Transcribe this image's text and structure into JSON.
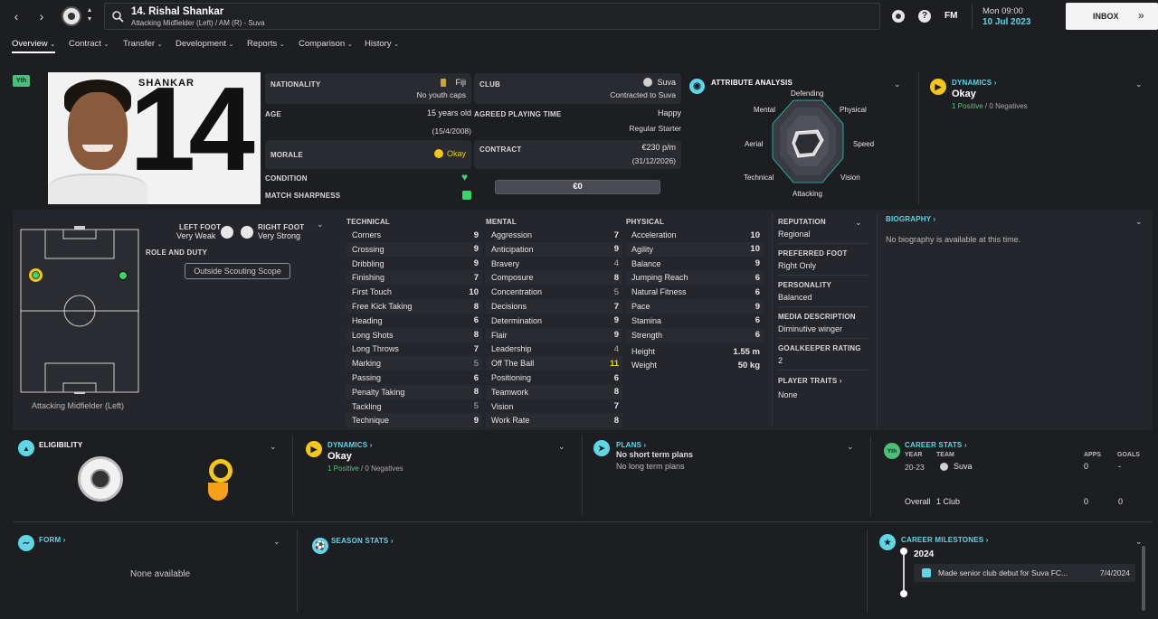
{
  "header": {
    "title": "14. Rishal Shankar",
    "subtitle": "Attacking Midfielder (Left) / AM (R) - Suva",
    "fm_label": "FM",
    "time": "Mon 09:00",
    "date": "10 Jul 2023",
    "inbox": "INBOX"
  },
  "tabs": [
    {
      "label": "Overview"
    },
    {
      "label": "Contract"
    },
    {
      "label": "Transfer"
    },
    {
      "label": "Development"
    },
    {
      "label": "Reports"
    },
    {
      "label": "Comparison"
    },
    {
      "label": "History"
    }
  ],
  "profile": {
    "youth_badge": "Yth",
    "shirt_name": "SHANKAR",
    "shirt_number": "14",
    "nationality_label": "NATIONALITY",
    "nationality": "Fiji",
    "youth_caps": "No youth caps",
    "age_label": "AGE",
    "age": "15 years old",
    "dob": "(15/4/2008)",
    "morale_label": "MORALE",
    "morale": "Okay",
    "condition_label": "CONDITION",
    "sharpness_label": "MATCH SHARPNESS",
    "club_label": "CLUB",
    "club": "Suva",
    "contracted": "Contracted to Suva",
    "playing_time_label": "AGREED PLAYING TIME",
    "playing_time": "Happy",
    "playing_role": "Regular Starter",
    "contract_label": "CONTRACT",
    "wage": "€230 p/m",
    "contract_end": "(31/12/2026)",
    "value": "€0"
  },
  "analysis": {
    "title": "ATTRIBUTE ANALYSIS",
    "labels": {
      "defending": "Defending",
      "physical": "Physical",
      "speed": "Speed",
      "vision": "Vision",
      "attacking": "Attacking",
      "technical": "Technical",
      "aerial": "Aerial",
      "mental": "Mental"
    }
  },
  "dynamics_top": {
    "title": "DYNAMICS",
    "value": "Okay",
    "positive": "1 Positive",
    "sep": "/",
    "negative": "0 Negatives"
  },
  "position": {
    "left_foot_label": "LEFT FOOT",
    "left_foot": "Very Weak",
    "right_foot_label": "RIGHT FOOT",
    "right_foot": "Very Strong",
    "role_duty": "ROLE AND DUTY",
    "scouting_scope": "Outside Scouting Scope",
    "pitch_caption": "Attacking Midfielder (Left)"
  },
  "attributes": {
    "technical_title": "TECHNICAL",
    "technical": [
      {
        "name": "Corners",
        "value": "9"
      },
      {
        "name": "Crossing",
        "value": "9"
      },
      {
        "name": "Dribbling",
        "value": "9"
      },
      {
        "name": "Finishing",
        "value": "7"
      },
      {
        "name": "First Touch",
        "value": "10"
      },
      {
        "name": "Free Kick Taking",
        "value": "8"
      },
      {
        "name": "Heading",
        "value": "6"
      },
      {
        "name": "Long Shots",
        "value": "8"
      },
      {
        "name": "Long Throws",
        "value": "7"
      },
      {
        "name": "Marking",
        "value": "5"
      },
      {
        "name": "Passing",
        "value": "6"
      },
      {
        "name": "Penalty Taking",
        "value": "8"
      },
      {
        "name": "Tackling",
        "value": "5"
      },
      {
        "name": "Technique",
        "value": "9"
      }
    ],
    "mental_title": "MENTAL",
    "mental": [
      {
        "name": "Aggression",
        "value": "7"
      },
      {
        "name": "Anticipation",
        "value": "9"
      },
      {
        "name": "Bravery",
        "value": "4"
      },
      {
        "name": "Composure",
        "value": "8"
      },
      {
        "name": "Concentration",
        "value": "5"
      },
      {
        "name": "Decisions",
        "value": "7"
      },
      {
        "name": "Determination",
        "value": "9"
      },
      {
        "name": "Flair",
        "value": "9"
      },
      {
        "name": "Leadership",
        "value": "4"
      },
      {
        "name": "Off The Ball",
        "value": "11"
      },
      {
        "name": "Positioning",
        "value": "6"
      },
      {
        "name": "Teamwork",
        "value": "8"
      },
      {
        "name": "Vision",
        "value": "7"
      },
      {
        "name": "Work Rate",
        "value": "8"
      }
    ],
    "physical_title": "PHYSICAL",
    "physical": [
      {
        "name": "Acceleration",
        "value": "10"
      },
      {
        "name": "Agility",
        "value": "10"
      },
      {
        "name": "Balance",
        "value": "9"
      },
      {
        "name": "Jumping Reach",
        "value": "6"
      },
      {
        "name": "Natural Fitness",
        "value": "6"
      },
      {
        "name": "Pace",
        "value": "9"
      },
      {
        "name": "Stamina",
        "value": "6"
      },
      {
        "name": "Strength",
        "value": "6"
      }
    ],
    "height_label": "Height",
    "height": "1.55 m",
    "weight_label": "Weight",
    "weight": "50 kg"
  },
  "details": {
    "reputation_label": "REPUTATION",
    "reputation": "Regional",
    "preferred_foot_label": "PREFERRED FOOT",
    "preferred_foot": "Right Only",
    "personality_label": "PERSONALITY",
    "personality": "Balanced",
    "media_label": "MEDIA DESCRIPTION",
    "media": "Diminutive winger",
    "gk_label": "GOALKEEPER RATING",
    "gk": "2",
    "traits_label": "PLAYER TRAITS",
    "traits": "None"
  },
  "biography": {
    "title": "BIOGRAPHY",
    "text": "No biography is available at this time."
  },
  "eligibility": {
    "title": "ELIGIBILITY"
  },
  "dynamics_bottom": {
    "title": "DYNAMICS",
    "value": "Okay",
    "positive": "1 Positive",
    "sep": "/",
    "negative": "0 Negatives"
  },
  "plans": {
    "title": "PLANS",
    "headline": "No short term plans",
    "text": "No long term plans"
  },
  "career_stats": {
    "title": "CAREER STATS",
    "badge": "Yth",
    "year_h": "YEAR",
    "team_h": "TEAM",
    "apps_h": "APPS",
    "goals_h": "GOALS",
    "rows": [
      {
        "year": "20-23",
        "team": "Suva",
        "apps": "0",
        "goals": "-"
      }
    ],
    "overall_label": "Overall",
    "overall_clubs": "1 Club",
    "overall_apps": "0",
    "overall_goals": "0"
  },
  "form": {
    "title": "FORM",
    "text": "None available"
  },
  "season_stats": {
    "title": "SEASON STATS"
  },
  "milestones": {
    "title": "CAREER MILESTONES",
    "year": "2024",
    "event": "Made senior club debut for Suva FC...",
    "date": "7/4/2024"
  },
  "colors": {
    "accent": "#5ed6e6",
    "positive": "#3ad66a",
    "morale": "#f5c518",
    "background": "#1d1e22"
  }
}
